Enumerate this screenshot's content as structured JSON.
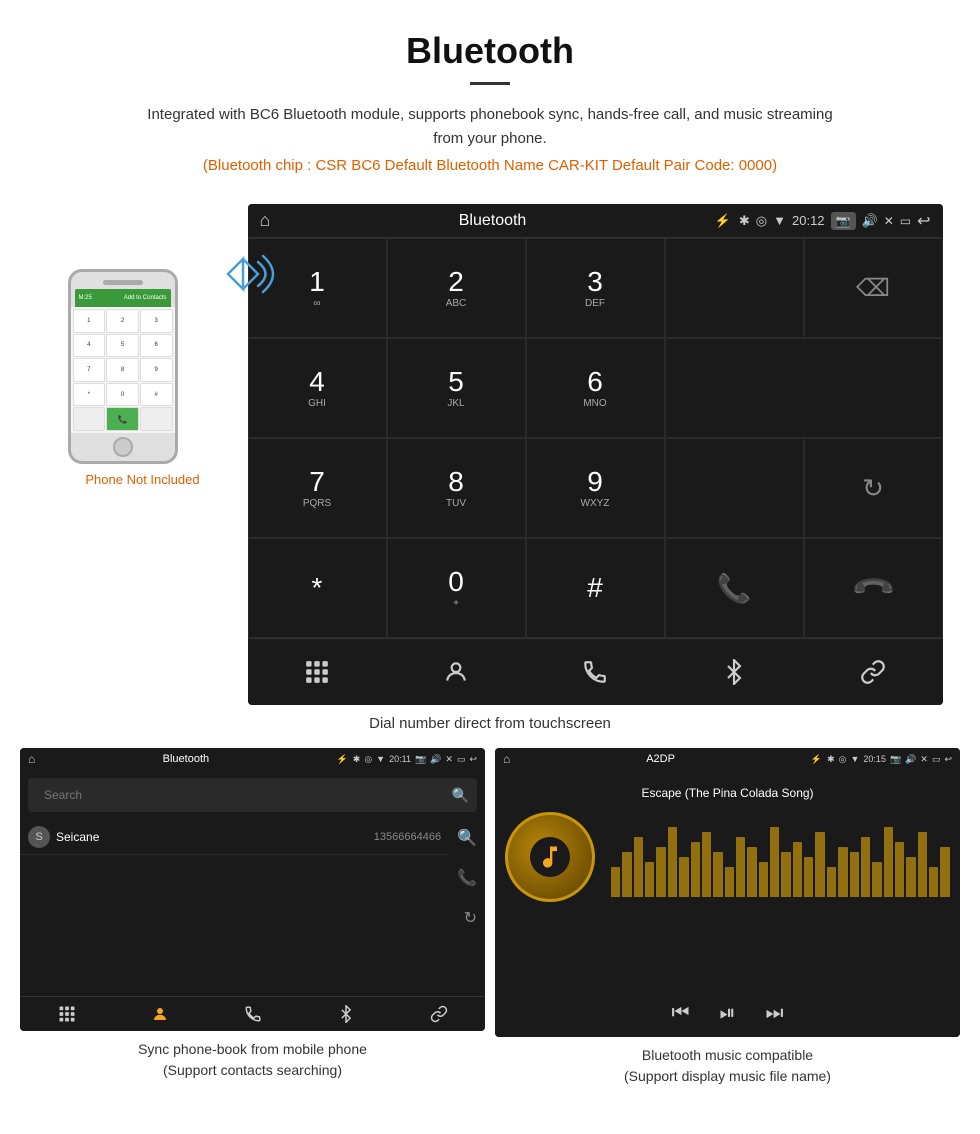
{
  "header": {
    "title": "Bluetooth",
    "description": "Integrated with BC6 Bluetooth module, supports phonebook sync, hands-free call, and music streaming from your phone.",
    "orange_info": "(Bluetooth chip : CSR BC6    Default Bluetooth Name CAR-KIT    Default Pair Code: 0000)"
  },
  "phone": {
    "not_included_label": "Phone Not Included"
  },
  "big_screen": {
    "status_bar": {
      "label": "Bluetooth",
      "time": "20:12"
    },
    "dial_keys": [
      {
        "num": "1",
        "sub": "∞",
        "col": 1
      },
      {
        "num": "2",
        "sub": "ABC",
        "col": 2
      },
      {
        "num": "3",
        "sub": "DEF",
        "col": 3
      },
      {
        "num": "4",
        "sub": "GHI",
        "col": 1
      },
      {
        "num": "5",
        "sub": "JKL",
        "col": 2
      },
      {
        "num": "6",
        "sub": "MNO",
        "col": 3
      },
      {
        "num": "7",
        "sub": "PQRS",
        "col": 1
      },
      {
        "num": "8",
        "sub": "TUV",
        "col": 2
      },
      {
        "num": "9",
        "sub": "WXYZ",
        "col": 3
      },
      {
        "num": "*",
        "sub": "",
        "col": 1
      },
      {
        "num": "0",
        "sub": "+",
        "col": 2
      },
      {
        "num": "#",
        "sub": "",
        "col": 3
      }
    ],
    "caption": "Dial number direct from touchscreen"
  },
  "contacts_screen": {
    "status_bar": {
      "label": "Bluetooth",
      "time": "20:11"
    },
    "search_placeholder": "Search",
    "contact": {
      "initial": "S",
      "name": "Seicane",
      "number": "13566664466"
    },
    "caption_line1": "Sync phone-book from mobile phone",
    "caption_line2": "(Support contacts searching)"
  },
  "music_screen": {
    "status_bar": {
      "label": "A2DP",
      "time": "20:15"
    },
    "song_title": "Escape (The Pina Colada Song)",
    "caption_line1": "Bluetooth music compatible",
    "caption_line2": "(Support display music file name)"
  },
  "bottom_nav_icons": [
    "⊞",
    "👤",
    "📞",
    "✱",
    "🔗"
  ],
  "eq_bar_heights": [
    30,
    45,
    60,
    35,
    50,
    70,
    40,
    55,
    65,
    45,
    30,
    60,
    50,
    35,
    70,
    45,
    55,
    40,
    65,
    30,
    50,
    45,
    60,
    35,
    70,
    55,
    40,
    65,
    30,
    50
  ]
}
